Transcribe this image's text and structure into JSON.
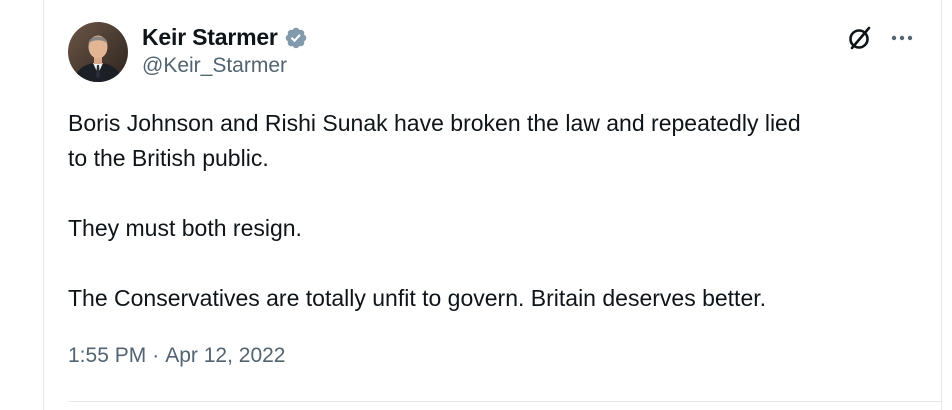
{
  "author": {
    "display_name": "Keir Starmer",
    "handle": "@Keir_Starmer",
    "verified": true
  },
  "tweet": {
    "lines": [
      "Boris Johnson and Rishi Sunak have broken the law and repeatedly lied",
      "to the British public.",
      "They must both resign.",
      "The Conservatives are totally unfit to govern. Britain deserves better."
    ],
    "time": "1:55 PM",
    "separator": "·",
    "date": "Apr 12, 2022"
  },
  "icons": {
    "verified": "verified-badge-icon",
    "grok": "grok-icon",
    "more": "more-icon"
  },
  "colors": {
    "text": "#0f1419",
    "secondary": "#536471",
    "verified_badge": "#829aab",
    "divider": "#e6e9ec"
  }
}
